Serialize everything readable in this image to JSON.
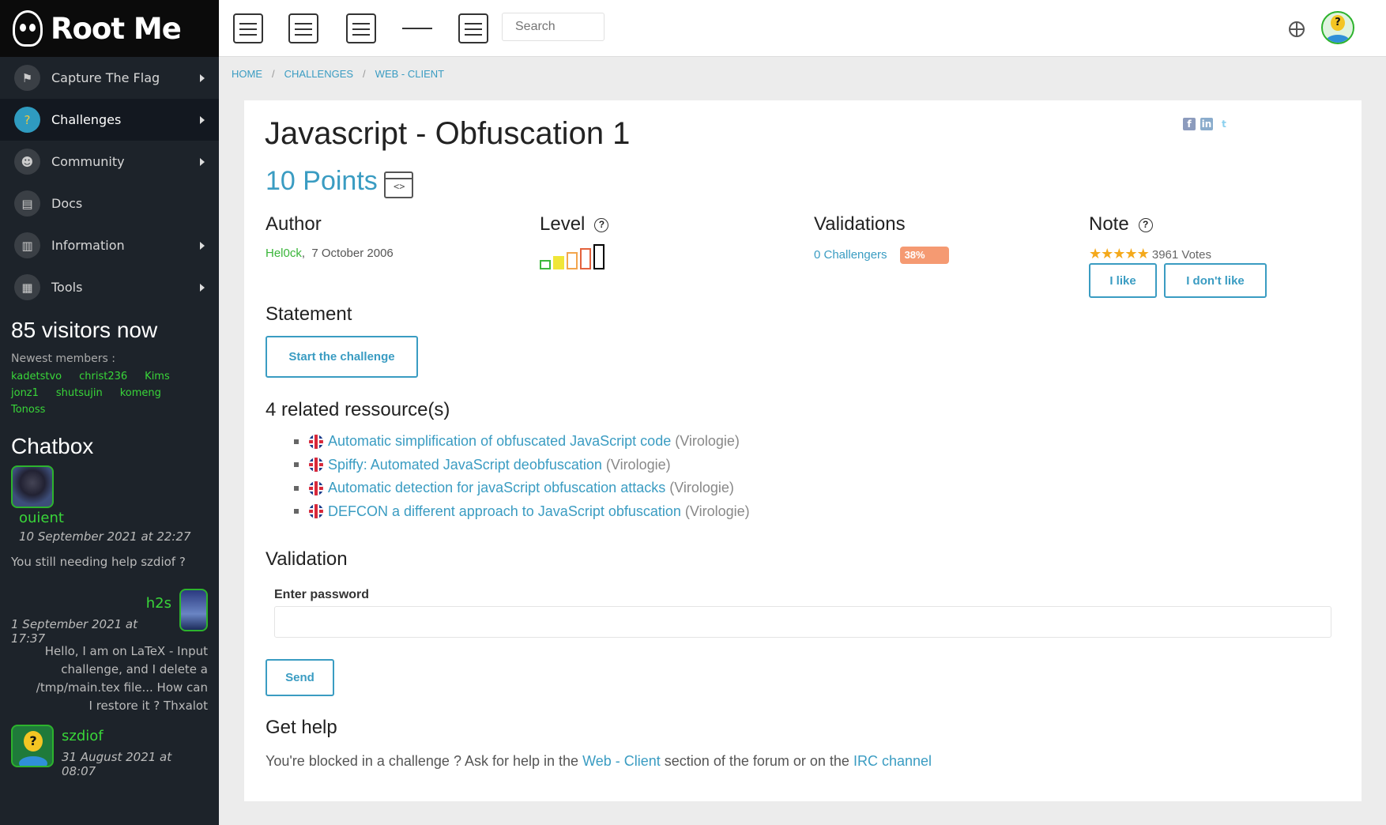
{
  "brand": {
    "logo_text": "Root Me"
  },
  "sidebar": {
    "items": [
      {
        "label": "Capture The Flag",
        "icon": "flag-icon",
        "glyph": "⚑",
        "caret": true,
        "active": false
      },
      {
        "label": "Challenges",
        "icon": "challenges-icon",
        "glyph": "?",
        "caret": true,
        "active": true
      },
      {
        "label": "Community",
        "icon": "community-icon",
        "glyph": "☻",
        "caret": true,
        "active": false
      },
      {
        "label": "Docs",
        "icon": "docs-icon",
        "glyph": "▤",
        "caret": false,
        "active": false
      },
      {
        "label": "Information",
        "icon": "information-icon",
        "glyph": "▥",
        "caret": true,
        "active": false
      },
      {
        "label": "Tools",
        "icon": "tools-icon",
        "glyph": "▦",
        "caret": true,
        "active": false
      }
    ],
    "visitors_title": "85 visitors now",
    "newest_label": "Newest members :",
    "members": [
      "kadetstvo",
      "christ236",
      "Kims",
      "jonz1",
      "shutsujin",
      "komeng",
      "Tonoss"
    ]
  },
  "chatbox": {
    "title": "Chatbox",
    "messages": [
      {
        "user": "ouient",
        "date": "10 September 2021 at 22:27",
        "text": "You still needing help szdiof ?"
      },
      {
        "user": "h2s",
        "date": "1 September 2021 at 17:37",
        "text": "Hello, I am on LaTeX - Input challenge, and I delete a /tmp/main.tex file... How can I restore it ? Thxalot"
      },
      {
        "user": "szdiof",
        "date": "31 August 2021 at 08:07"
      }
    ]
  },
  "topbar": {
    "icons": [
      "faq-icon",
      "irc-icon",
      "documentation-icon",
      "activity-icon",
      "shop-icon"
    ],
    "search_placeholder": "Search",
    "right_icons": [
      "globe-icon",
      "user-avatar"
    ]
  },
  "breadcrumb": {
    "home": "HOME",
    "challenges": "CHALLENGES",
    "category": "WEB - CLIENT",
    "separator": "/"
  },
  "challenge": {
    "title": "Javascript - Obfuscation 1",
    "points": "10 Points",
    "author_heading": "Author",
    "author": "Hel0ck",
    "author_date": "7 October 2006",
    "level_heading": "Level",
    "level": 1,
    "level_max": 5,
    "validations_heading": "Validations",
    "challengers": "0 Challengers",
    "validation_rate": "38%",
    "note_heading": "Note",
    "rating_stars": 5,
    "votes": "3961 Votes",
    "like_label": "I like",
    "dislike_label": "I don't like",
    "statement_heading": "Statement",
    "start_label": "Start the challenge",
    "resources_heading": "4 related ressource(s)",
    "resources": [
      {
        "title": "Automatic simplification of obfuscated JavaScript code",
        "source": "(Virologie)"
      },
      {
        "title": "Spiffy: Automated JavaScript deobfuscation",
        "source": "(Virologie)"
      },
      {
        "title": "Automatic detection for javaScript obfuscation attacks",
        "source": "(Virologie)"
      },
      {
        "title": "DEFCON a different approach to JavaScript obfuscation",
        "source": "(Virologie)"
      }
    ],
    "validation_heading": "Validation",
    "password_label": "Enter password",
    "password_value": "",
    "send_label": "Send",
    "help_heading": "Get help",
    "help_text_1": "You're blocked in a challenge ? Ask for help in the",
    "help_link_1": "Web - Client",
    "help_text_2": "section of the forum or on the",
    "help_link_2": "IRC channel"
  },
  "colors": {
    "accent": "#3a9cc2",
    "member_green": "#39d639",
    "sidebar_bg": "#1d232a",
    "rate_badge": "#f59a72",
    "star": "#f4a91b"
  }
}
